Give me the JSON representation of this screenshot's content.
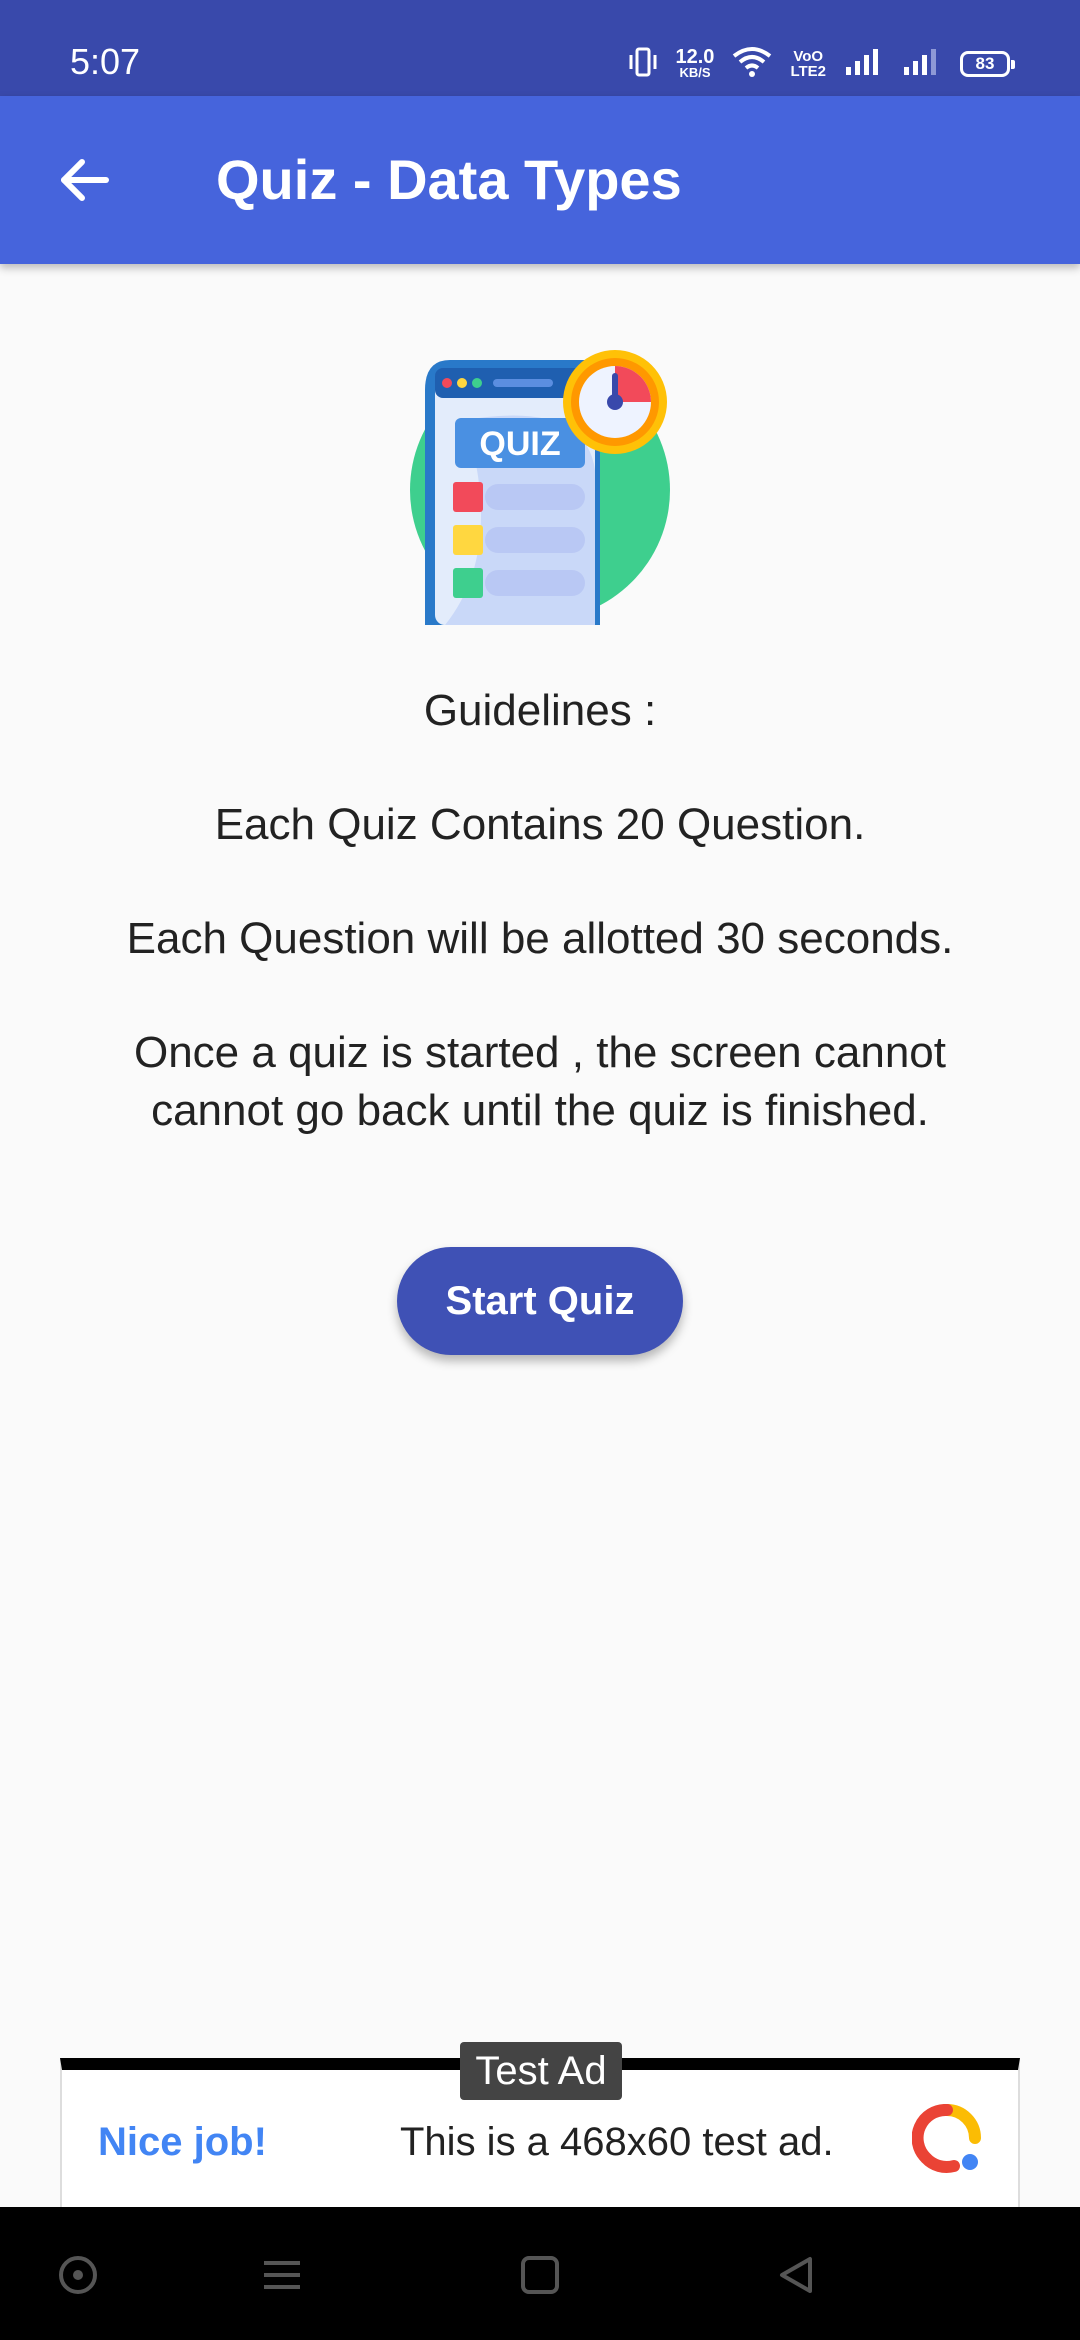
{
  "status_bar": {
    "time": "5:07",
    "net_speed_value": "12.0",
    "net_speed_unit": "KB/S",
    "volte_top": "VoO",
    "volte_bottom": "LTE2",
    "battery": "83"
  },
  "app_bar": {
    "title": "Quiz - Data Types"
  },
  "illustration": {
    "label": "QUIZ"
  },
  "guidelines": {
    "heading": "Guidelines :",
    "line1": "Each Quiz Contains 20 Question.",
    "line2": "Each Question will be allotted 30 seconds.",
    "line3a": "Once a quiz is started , the screen cannot",
    "line3b": "cannot go back until the quiz is finished."
  },
  "start_button": {
    "label": "Start Quiz"
  },
  "ad": {
    "tag": "Test Ad",
    "cta": "Nice job!",
    "text": "This is a 468x60 test ad."
  },
  "colors": {
    "status_bar": "#3949ab",
    "app_bar": "#4664dc",
    "button": "#3f51b5",
    "background": "#fafafa"
  }
}
